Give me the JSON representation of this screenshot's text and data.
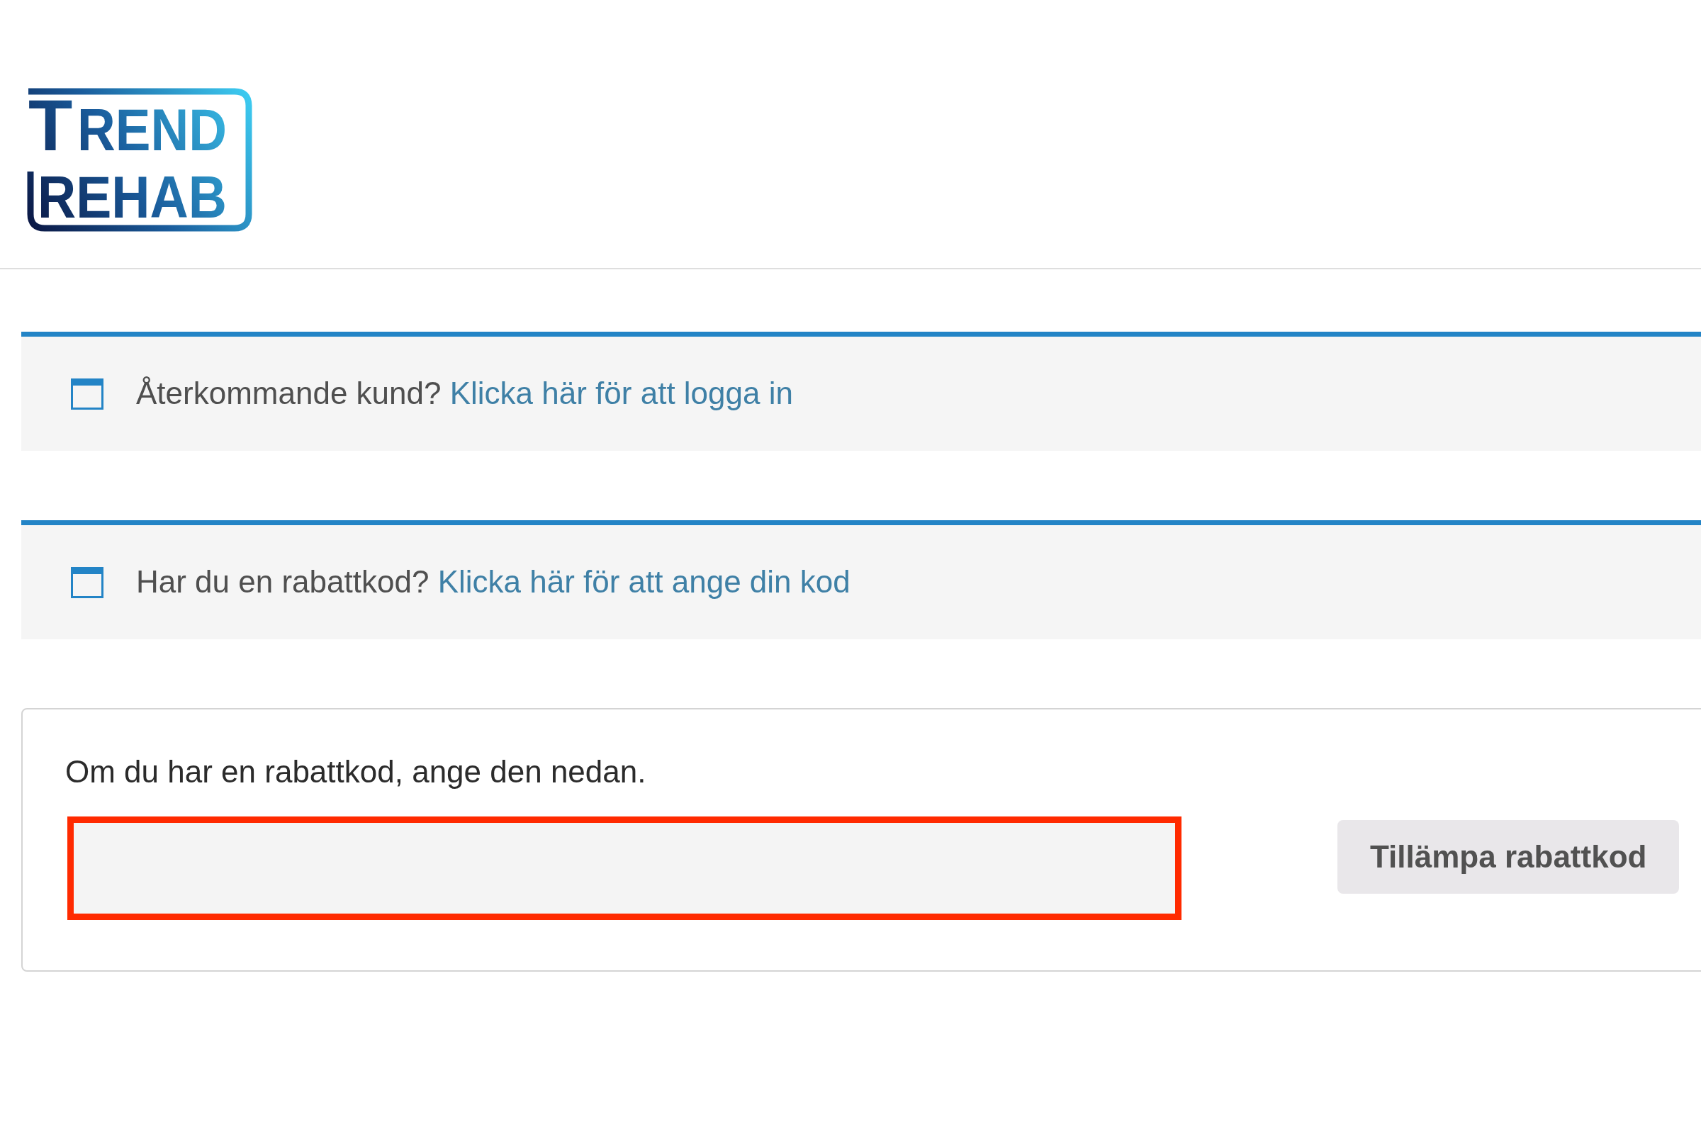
{
  "header": {
    "logo": {
      "line_1": "TREND",
      "line_2": "REHAB"
    }
  },
  "notices": [
    {
      "text": "Återkommande kund?",
      "link": "Klicka här för att logga in"
    },
    {
      "text": "Har du en rabattkod?",
      "link": "Klicka här för att ange din kod"
    }
  ],
  "coupon_form": {
    "prompt": "Om du har en rabattkod, ange den nedan.",
    "field": {
      "highlighted": true
    },
    "button": "Tillämpa rabattkod"
  }
}
